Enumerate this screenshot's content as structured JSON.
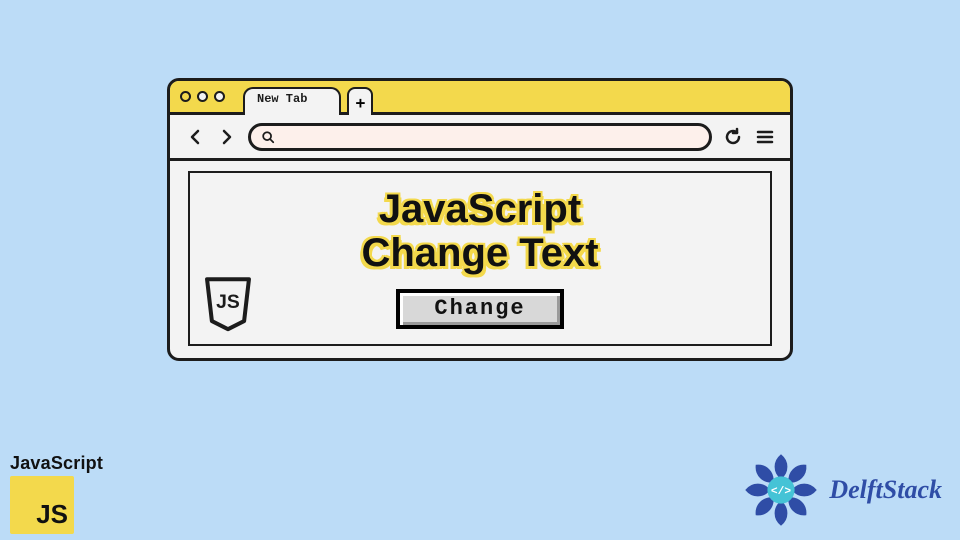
{
  "browser": {
    "tab_label": "New Tab",
    "add_tab_glyph": "+",
    "nav": {
      "back_glyph": "<",
      "forward_glyph": ">",
      "search_icon": "search-icon",
      "refresh_icon": "refresh-icon",
      "menu_icon": "hamburger-icon"
    }
  },
  "content": {
    "headline_line1": "JavaScript",
    "headline_line2": "Change Text",
    "button_label": "Change",
    "shield_label": "JS"
  },
  "corners": {
    "left_label": "JavaScript",
    "left_box": "JS",
    "right_label": "DelftStack",
    "right_code_glyph": "</>"
  },
  "colors": {
    "page_bg": "#bcdcf7",
    "accent_yellow": "#f3d94c",
    "brand_blue": "#2f4da6"
  }
}
